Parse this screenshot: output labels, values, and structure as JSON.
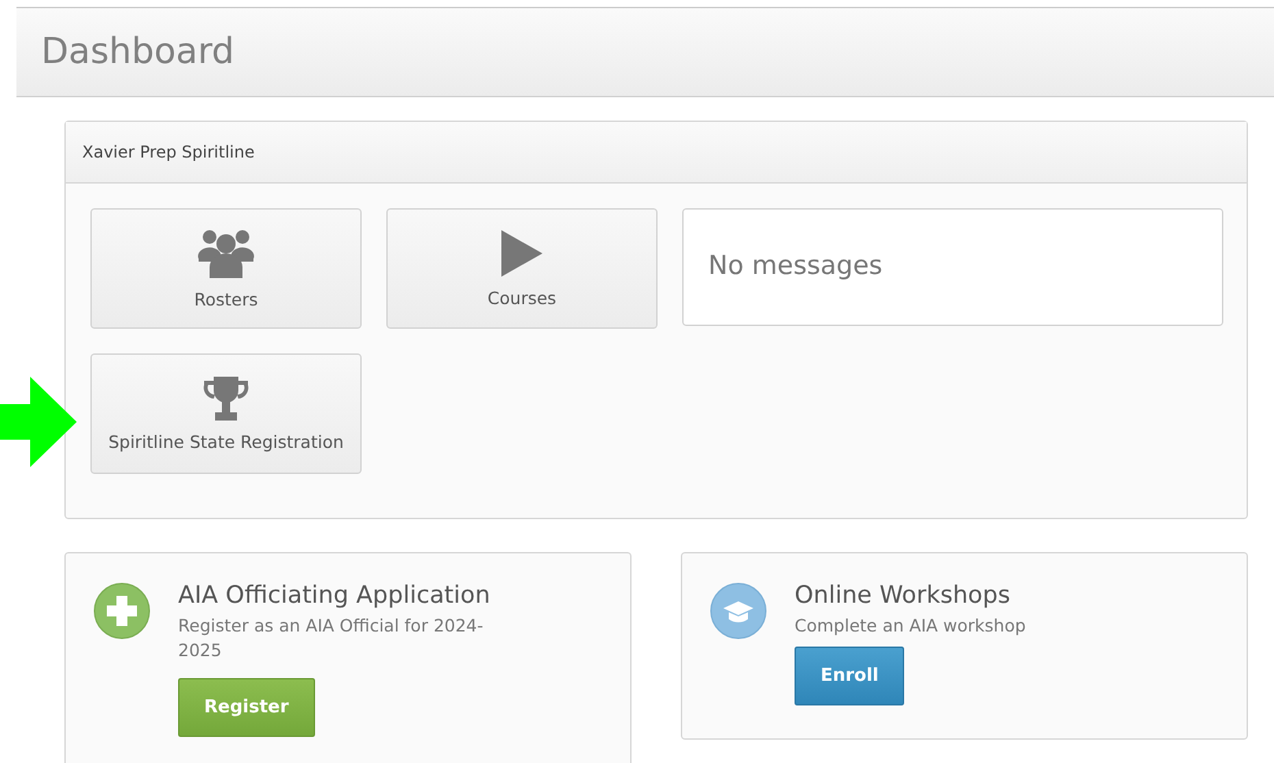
{
  "page_title": "Dashboard",
  "panel": {
    "title": "Xavier Prep Spiritline",
    "tiles": [
      {
        "kind": "group",
        "label": "Rosters"
      },
      {
        "kind": "play",
        "label": "Courses"
      },
      {
        "kind": "trophy",
        "label": "Spiritline State Registration"
      }
    ],
    "messages": "No messages"
  },
  "annotation": {
    "kind": "arrow",
    "color": "#00ff00"
  },
  "cards": [
    {
      "kind": "add",
      "title": "AIA Officiating Application",
      "description": "Register as an AIA Official for 2024-2025",
      "button": "Register"
    },
    {
      "kind": "education",
      "title": "Online Workshops",
      "description": "Complete an AIA workshop",
      "button": "Enroll"
    }
  ]
}
